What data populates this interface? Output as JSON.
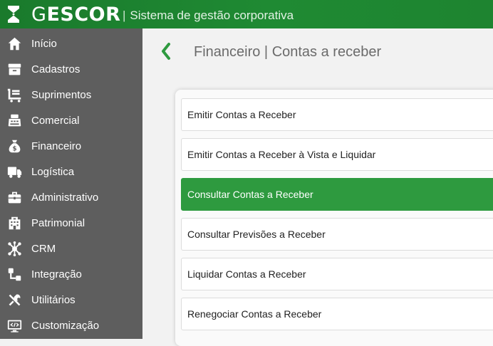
{
  "header": {
    "brand_initial": "G",
    "brand_rest": "ESCOR",
    "separator": "|",
    "subtitle": "Sistema de gestão corporativa"
  },
  "sidebar": {
    "items": [
      {
        "label": "Início",
        "icon": "home-icon"
      },
      {
        "label": "Cadastros",
        "icon": "archive-icon"
      },
      {
        "label": "Suprimentos",
        "icon": "cart-icon"
      },
      {
        "label": "Comercial",
        "icon": "cash-register-icon"
      },
      {
        "label": "Financeiro",
        "icon": "money-bag-icon"
      },
      {
        "label": "Logística",
        "icon": "truck-icon"
      },
      {
        "label": "Administrativo",
        "icon": "briefcase-icon"
      },
      {
        "label": "Patrimonial",
        "icon": "building-icon"
      },
      {
        "label": "CRM",
        "icon": "network-icon"
      },
      {
        "label": "Integração",
        "icon": "integration-icon"
      },
      {
        "label": "Utilitários",
        "icon": "tools-icon"
      },
      {
        "label": "Customização",
        "icon": "code-monitor-icon"
      }
    ]
  },
  "main": {
    "title": "Financeiro | Contas a receber",
    "options": [
      {
        "label": "Emitir Contas a Receber",
        "active": false
      },
      {
        "label": "Emitir Contas a Receber à Vista e Liquidar",
        "active": false
      },
      {
        "label": "Consultar Contas a Receber",
        "active": true
      },
      {
        "label": "Consultar Previsões a Receber",
        "active": false
      },
      {
        "label": "Liquidar Contas a Receber",
        "active": false
      },
      {
        "label": "Renegociar Contas a Receber",
        "active": false
      }
    ]
  },
  "colors": {
    "header_green": "#1f8a33",
    "sidebar_bg": "#5e5e5e",
    "active_option": "#2e9a3f",
    "back_arrow": "#2e9a3f"
  }
}
